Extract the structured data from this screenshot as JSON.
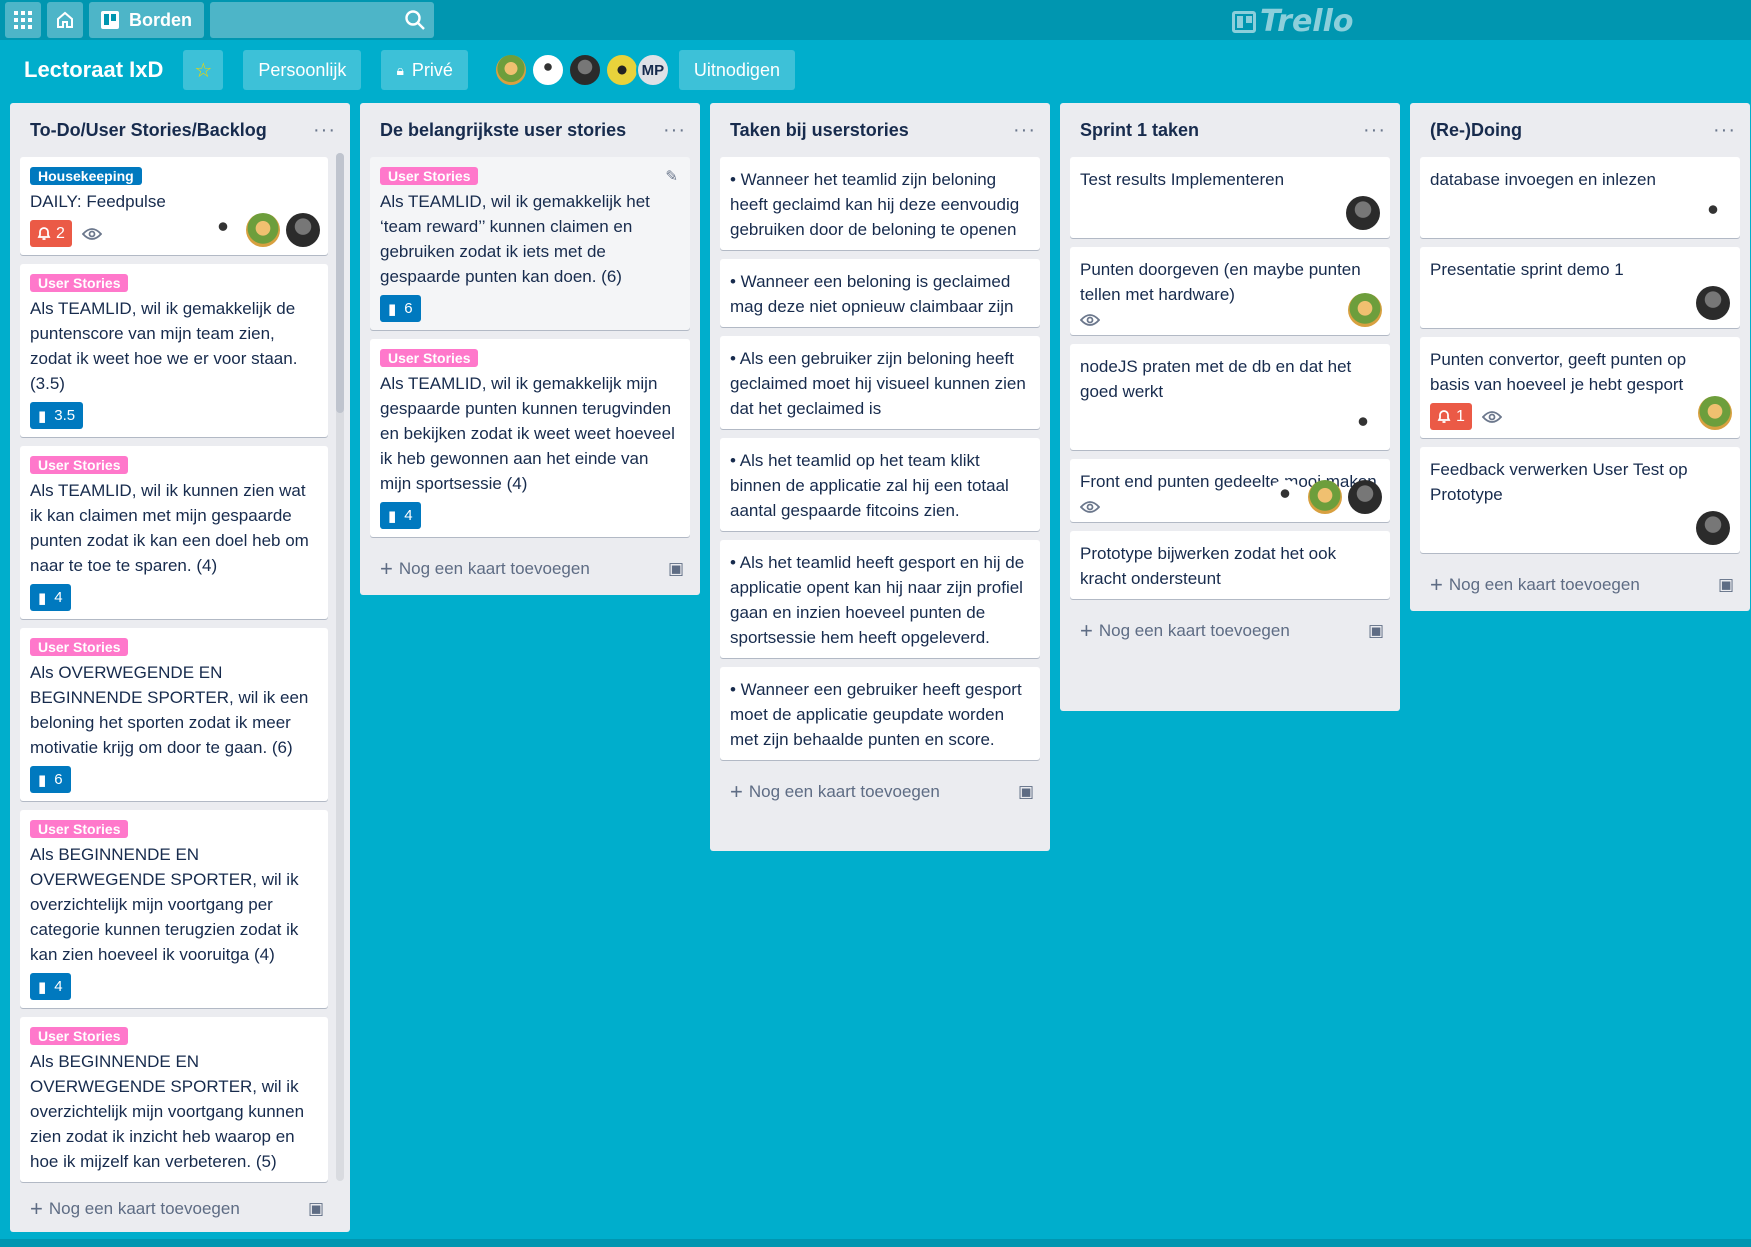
{
  "topbar": {
    "boards_label": "Borden",
    "search_placeholder": "",
    "logo_text": "Trello"
  },
  "board": {
    "title": "Lectoraat IxD",
    "visibility_team": "Persoonlijk",
    "visibility_private": "Privé",
    "invite_label": "Uitnodigen",
    "member_initials": "MP"
  },
  "colors": {
    "background": "#00aecc",
    "label_housekeeping": "#0079bf",
    "label_user_stories": "#ff78cb",
    "badge_red": "#eb5a46"
  },
  "add_card_label": "Nog een kaart toevoegen",
  "lists": [
    {
      "title": "To-Do/User Stories/Backlog",
      "cards": [
        {
          "label": "Housekeeping",
          "text": "DAILY: Feedpulse",
          "notif": "2"
        },
        {
          "label": "User Stories",
          "text": "Als TEAMLID, wil ik gemakkelijk de puntenscore van mijn team zien, zodat ik weet hoe we er voor staan. (3.5)",
          "points": "3.5"
        },
        {
          "label": "User Stories",
          "text": "Als TEAMLID, wil ik kunnen zien wat ik kan claimen met mijn gespaarde punten zodat ik kan een doel heb om naar te toe te sparen. (4)",
          "points": "4"
        },
        {
          "label": "User Stories",
          "text": "Als OVERWEGENDE EN BEGINNENDE SPORTER, wil ik een beloning het sporten zodat ik meer motivatie krijg om door te gaan. (6)",
          "points": "6"
        },
        {
          "label": "User Stories",
          "text": "Als BEGINNENDE EN OVERWEGENDE SPORTER, wil ik overzichtelijk mijn voortgang per categorie kunnen terugzien zodat ik kan zien hoeveel ik vooruitga (4)",
          "points": "4"
        },
        {
          "label": "User Stories",
          "text": "Als BEGINNENDE EN OVERWEGENDE SPORTER, wil ik overzichtelijk mijn voortgang kunnen zien zodat ik inzicht heb waarop en hoe ik mijzelf kan verbeteren. (5)"
        }
      ]
    },
    {
      "title": "De belangrijkste user stories",
      "cards": [
        {
          "label": "User Stories",
          "text": "Als TEAMLID, wil ik gemakkelijk het ‘team reward’’ kunnen claimen en gebruiken zodat ik iets met de gespaarde punten kan doen. (6)",
          "points": "6"
        },
        {
          "label": "User Stories",
          "text": "Als TEAMLID, wil ik gemakkelijk mijn gespaarde punten kunnen terugvinden en bekijken zodat ik weet weet hoeveel ik heb gewonnen aan het einde van mijn sportsessie (4)",
          "points": "4"
        }
      ]
    },
    {
      "title": "Taken bij userstories",
      "cards": [
        {
          "text": "• Wanneer het teamlid zijn beloning heeft geclaimd kan hij deze eenvoudig gebruiken door de beloning te openen"
        },
        {
          "text": "• Wanneer een beloning is geclaimed mag deze niet opnieuw claimbaar zijn"
        },
        {
          "text": "• Als een gebruiker zijn beloning heeft geclaimed moet hij visueel kunnen zien dat het geclaimed is"
        },
        {
          "text": "• Als het teamlid op het team klikt binnen de applicatie zal hij een totaal aantal gespaarde fitcoins zien."
        },
        {
          "text": "• Als het teamlid heeft gesport en hij de applicatie opent kan hij naar zijn profiel gaan en inzien hoeveel punten de sportsessie hem heeft opgeleverd."
        },
        {
          "text": "• Wanneer een gebruiker heeft gesport moet de applicatie geupdate worden met zijn behaalde punten en score."
        }
      ]
    },
    {
      "title": "Sprint 1 taken",
      "cards": [
        {
          "text": "Test results Implementeren"
        },
        {
          "text": "Punten doorgeven (en maybe punten tellen met hardware)"
        },
        {
          "text": "nodeJS praten met de db en dat het goed werkt"
        },
        {
          "text": "Front end punten gedeelte mooi maken"
        },
        {
          "text": "Prototype bijwerken zodat het ook kracht ondersteunt"
        }
      ]
    },
    {
      "title": "(Re-)Doing",
      "cards": [
        {
          "text": "database invoegen en inlezen"
        },
        {
          "text": "Presentatie sprint demo 1"
        },
        {
          "text": "Punten convertor, geeft punten op basis van hoeveel je hebt gesport",
          "notif": "1"
        },
        {
          "text": "Feedback verwerken User Test op Prototype"
        }
      ]
    }
  ]
}
